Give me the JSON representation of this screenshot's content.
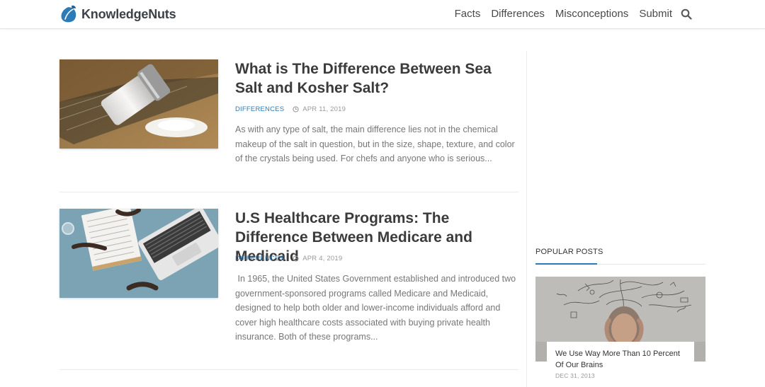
{
  "site": {
    "name": "KnowledgeNuts",
    "brand_color": "#2a7bb8"
  },
  "nav": {
    "items": [
      "Facts",
      "Differences",
      "Misconceptions",
      "Submit"
    ],
    "search_icon": "search-icon"
  },
  "posts": [
    {
      "title": "What is The Difference Between Sea Salt and Kosher Salt?",
      "category": "DIFFERENCES",
      "date": "APR 11, 2019",
      "excerpt": "As with any type of salt, the main difference lies not in the chemical makeup of the salt in question, but in the size, shape, texture, and color of the crystals being used. For chefs and anyone who is serious..."
    },
    {
      "title": "U.S Healthcare Programs: The Difference Between Medicare and Medicaid",
      "category": "DIFFERENCES",
      "date": "APR 4, 2019",
      "excerpt": " In 1965, the United States Government established and introduced two government-sponsored programs called Medicare and Medicaid, designed to help both older and lower-income individuals afford and cover high healthcare costs associated with buying private health insurance. Both of these programs..."
    }
  ],
  "sidebar": {
    "heading": "POPULAR POSTS",
    "popular": [
      {
        "title": "We Use Way More Than 10 Percent Of Our Brains",
        "date": "DEC 31, 2013"
      }
    ]
  }
}
